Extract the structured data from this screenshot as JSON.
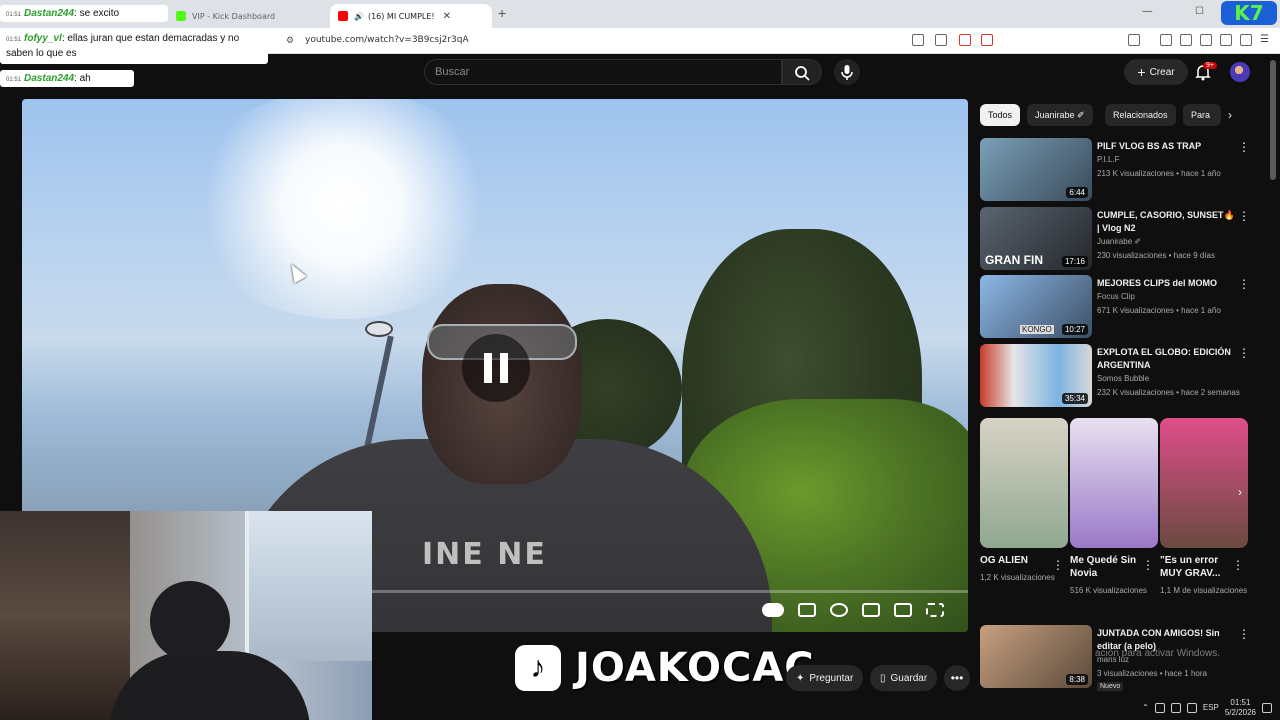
{
  "browser": {
    "tabs": [
      {
        "label": "",
        "active": false
      },
      {
        "label": "VIP - Kick Dashboard",
        "active": false
      },
      {
        "label": "(16) MI CUMPLE!",
        "active": true
      }
    ],
    "new_tab": "+",
    "url": "youtube.com/watch?v=3B9csj2r3qA",
    "kick_logo_text": "K7"
  },
  "chat": [
    {
      "time": "01:51",
      "user": "Dastan244",
      "message": ": se excito"
    },
    {
      "time": "01:51",
      "user": "fofyy_vl",
      "message": ": ellas juran que estan demacradas y no saben lo que es"
    },
    {
      "time": "01:51",
      "user": "Dastan244",
      "message": ": ah"
    }
  ],
  "header": {
    "search_placeholder": "Buscar",
    "crear_label": "Crear",
    "notif_count": "9+"
  },
  "video": {
    "shirt_text": "INE NE",
    "progress": 0.0
  },
  "brand": {
    "tiktok_glyph": "♪",
    "name": "JOAKOCAC"
  },
  "actions": {
    "preguntar": "Preguntar",
    "guardar": "Guardar",
    "more": "•••"
  },
  "chips": [
    "Todos",
    "Juanirabe ✐",
    "Relacionados",
    "Para"
  ],
  "recommendations": [
    {
      "title": "PILF VLOG BS AS TRAP",
      "channel": "P.I.L.F",
      "meta": "213 K visualizaciones • hace 1 año",
      "duration": "6:44"
    },
    {
      "title": "CUMPLE, CASORIO, SUNSET🔥 | Vlog N2",
      "channel": "Juanirabe ✐",
      "meta": "230 visualizaciones • hace 9 días",
      "duration": "17:16",
      "overlay": "GRAN FIN"
    },
    {
      "title": "MEJORES CLIPS del MOMO",
      "channel": "Focus Clip",
      "meta": "671 K visualizaciones • hace 1 año",
      "duration": "10:27",
      "overlay": "KONGO"
    },
    {
      "title": "EXPLOTA EL GLOBO: EDICIÓN ARGENTINA",
      "channel": "Somos Bubble",
      "meta": "232 K visualizaciones • hace 2 semanas",
      "duration": "35:34"
    },
    {
      "title": "JUNTADA CON AMIGOS! Sin editar (a pelo)",
      "channel": "mans luz",
      "meta": "3 visualizaciones • hace 1 hora",
      "duration": "8:38",
      "badge": "Nuevo"
    }
  ],
  "shorts": [
    {
      "title": "OG ALIEN",
      "meta": "1,2 K visualizaciones"
    },
    {
      "title": "Me Quedé Sin Novia",
      "meta": "516 K visualizaciones"
    },
    {
      "title": "\"Es un error MUY GRAV...",
      "meta": "1,1 M de visualizaciones"
    }
  ],
  "watermark": "ación para activar Windows.",
  "taskbar": {
    "lang": "ESP",
    "time": "01:51",
    "date": "5/2/2026"
  }
}
